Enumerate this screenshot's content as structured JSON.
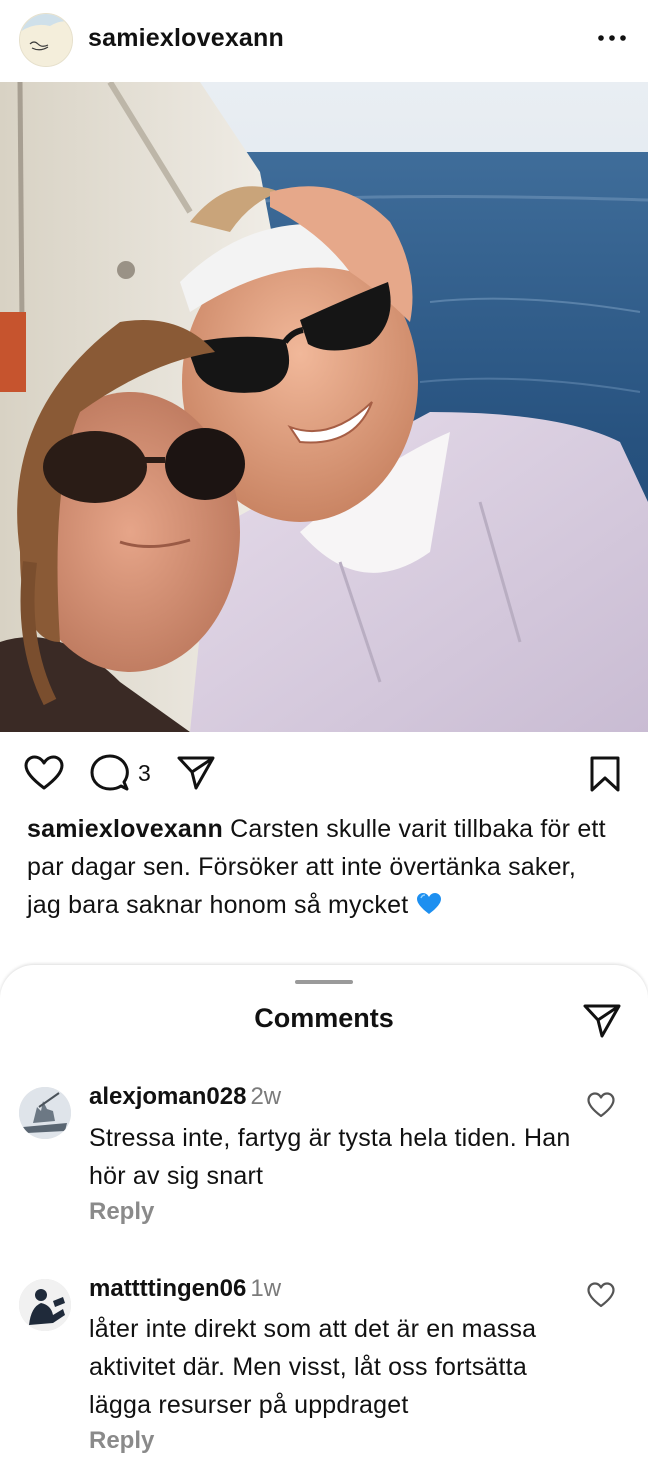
{
  "post": {
    "username": "samiexlovexann",
    "comment_count": "3",
    "caption_user": "samiexlovexann",
    "caption_text": "Carsten skulle varit tillbaka för ett par dagar sen. Försöker att inte övertänka saker, jag bara saknar honom så mycket",
    "caption_emoji": "blue-heart-emoji"
  },
  "comments_sheet": {
    "title": "Comments",
    "comments": [
      {
        "username": "alexjoman028",
        "time": "2w",
        "text": "Stressa inte, fartyg är tysta hela tiden. Han hör av sig snart",
        "reply_label": "Reply"
      },
      {
        "username": "mattttingen06",
        "time": "1w",
        "text": "låter inte direkt som att det är en massa aktivitet där. Men visst, låt oss fortsätta lägga resurser på uppdraget",
        "reply_label": "Reply"
      }
    ]
  },
  "icons": {
    "more": "more-horizontal-icon",
    "like": "heart-outline-icon",
    "comment": "comment-bubble-icon",
    "share": "paper-plane-icon",
    "save": "bookmark-icon"
  }
}
